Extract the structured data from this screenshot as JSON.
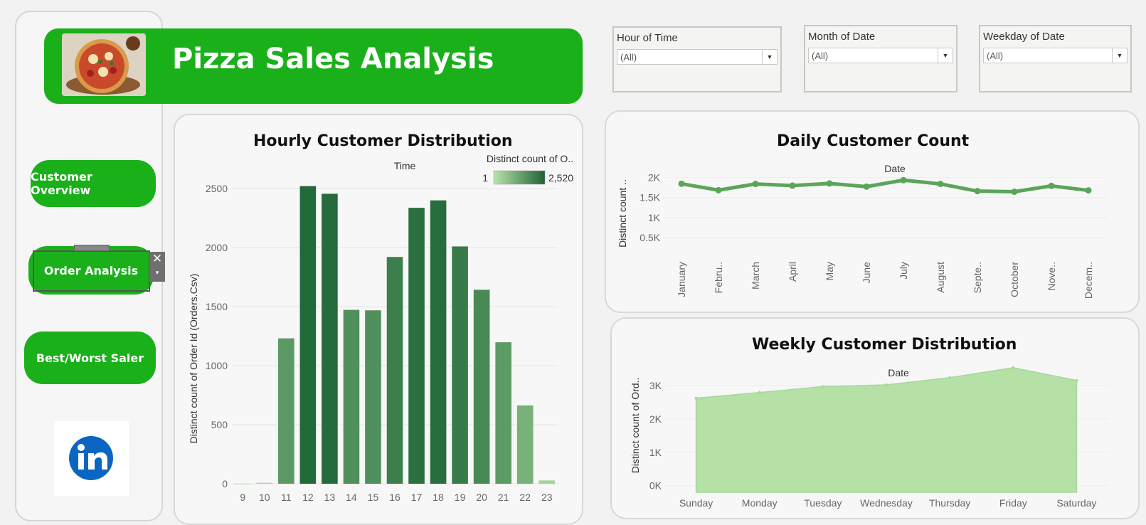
{
  "header": {
    "title": "Pizza Sales Analysis"
  },
  "nav": {
    "customer_overview": "Customer Overview",
    "order_analysis": "Order Analysis",
    "best_worst": "Best/Worst Saler"
  },
  "filters": [
    {
      "label": "Hour of Time",
      "value": "(All)"
    },
    {
      "label": "Month of Date",
      "value": "(All)"
    },
    {
      "label": "Weekday of Date",
      "value": "(All)"
    }
  ],
  "colors": {
    "brand": "#1ab01a",
    "bar_low": "#a6d89a",
    "bar_high": "#22693a",
    "line": "#5aa55a",
    "area": "#b5e1a7"
  },
  "icons": {
    "linkedin": "linkedin-icon",
    "close": "close-icon",
    "dropdown": "chevron-down-icon"
  },
  "chart_data": [
    {
      "type": "bar",
      "title": "Hourly Customer Distribution",
      "xlabel": "Time",
      "ylabel": "Distinct count of Order Id (Orders.Csv)",
      "legend_title": "Distinct count of O..",
      "legend_min": "1",
      "legend_max": "2,520",
      "categories": [
        "9",
        "10",
        "11",
        "12",
        "13",
        "14",
        "15",
        "16",
        "17",
        "18",
        "19",
        "20",
        "21",
        "22",
        "23"
      ],
      "values": [
        1,
        8,
        1231,
        2520,
        2455,
        1472,
        1468,
        1920,
        2336,
        2399,
        2009,
        1642,
        1198,
        663,
        28
      ],
      "ylim": [
        0,
        2650
      ],
      "yticks": [
        0,
        500,
        1000,
        1500,
        2000,
        2500
      ]
    },
    {
      "type": "line",
      "title": "Daily Customer Count",
      "xlabel": "Date",
      "ylabel": "Distinct count ..",
      "categories": [
        "January",
        "Febru..",
        "March",
        "April",
        "May",
        "June",
        "July",
        "August",
        "Septe..",
        "October",
        "Nove..",
        "Decem.."
      ],
      "values": [
        1845,
        1685,
        1840,
        1799,
        1853,
        1773,
        1935,
        1841,
        1661,
        1646,
        1792,
        1680
      ],
      "ylim": [
        0,
        2100
      ],
      "yticks": [
        500,
        1000,
        1500,
        2000
      ],
      "ytick_labels": [
        "0.5K",
        "1K",
        "1.5K",
        "2K"
      ]
    },
    {
      "type": "area",
      "title": "Weekly Customer Distribution",
      "xlabel": "Date",
      "ylabel": "Distinct count of Ord..",
      "categories": [
        "Sunday",
        "Monday",
        "Tuesday",
        "Wednesday",
        "Thursday",
        "Friday",
        "Saturday"
      ],
      "values": [
        2624,
        2794,
        2973,
        3024,
        3239,
        3538,
        3158
      ],
      "ylim": [
        -200,
        3600
      ],
      "yticks": [
        0,
        1000,
        2000,
        3000
      ],
      "ytick_labels": [
        "0K",
        "1K",
        "2K",
        "3K"
      ]
    }
  ]
}
